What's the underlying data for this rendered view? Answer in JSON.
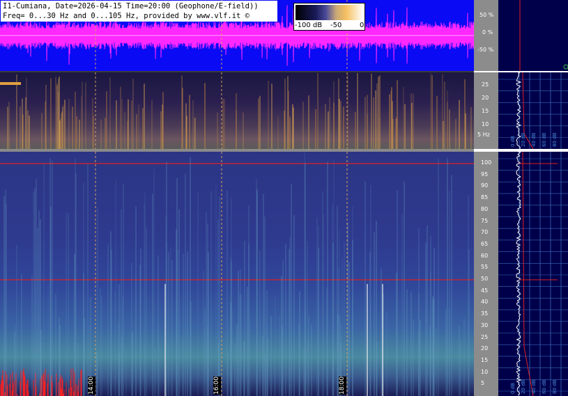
{
  "header": {
    "line1": "I1-Cumiana, Date=2026-04-15 Time=20:00 (Geophone/E-field))",
    "line2": "Freq= 0...30 Hz and 0...105 Hz, provided by www.vlf.it ©"
  },
  "colorbar": {
    "labels": [
      "-100 dB",
      "-50",
      "0"
    ]
  },
  "wave_axis": [
    "50 %",
    "0 %",
    "-50 %"
  ],
  "low_axis": [
    "25",
    "20",
    "15",
    "10",
    "5 Hz"
  ],
  "high_axis": [
    "100",
    "95",
    "90",
    "85",
    "80",
    "75",
    "70",
    "65",
    "60",
    "55",
    "50",
    "45",
    "40",
    "35",
    "30",
    "25",
    "20",
    "15",
    "10",
    "5"
  ],
  "time_markers": [
    "14:00",
    "16:00",
    "18:00"
  ],
  "side_low_labels": [
    "0 dB",
    "20 dB",
    "40 dB",
    "60 dB",
    "80 dB"
  ],
  "side_high_labels": [
    "0 dB",
    "20 dB",
    "40 dB",
    "60 dB",
    "80 dB"
  ],
  "colors": {
    "wave_bg": "#0a0af5",
    "wave_signal": "#ff28ff",
    "trace_red": "#e01010",
    "panel_bg": "#00004a"
  }
}
